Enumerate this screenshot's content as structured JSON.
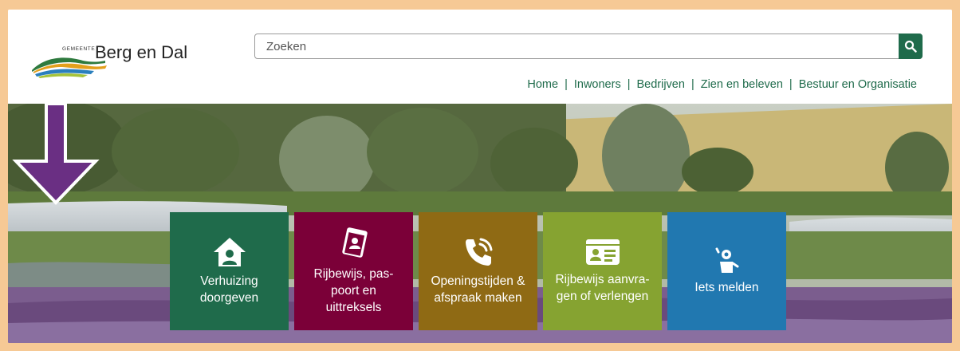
{
  "logo": {
    "small_text": "GEMEENTE",
    "name": "Berg en Dal"
  },
  "search": {
    "placeholder": "Zoeken"
  },
  "nav": {
    "items": [
      "Home",
      "Inwoners",
      "Bedrijven",
      "Zien en beleven",
      "Bestuur en Organisatie"
    ],
    "separator": "|"
  },
  "tiles": [
    {
      "label_line1": "Verhuizing",
      "label_line2": "doorgeven",
      "label_line3": "",
      "color": "#1f6b4b",
      "icon": "house-person-icon"
    },
    {
      "label_line1": "Rijbewijs, pas-",
      "label_line2": "poort en",
      "label_line3": "uittreksels",
      "color": "#7b0038",
      "icon": "passport-icon"
    },
    {
      "label_line1": "Openingstijden &",
      "label_line2": "afspraak maken",
      "label_line3": "",
      "color": "#8f6a14",
      "icon": "phone-icon"
    },
    {
      "label_line1": "Rijbewijs aanvra-",
      "label_line2": "gen of verlengen",
      "label_line3": "",
      "color": "#86a331",
      "icon": "id-card-icon"
    },
    {
      "label_line1": "Iets melden",
      "label_line2": "",
      "label_line3": "",
      "color": "#2178b0",
      "icon": "report-person-icon"
    }
  ],
  "colors": {
    "brand_green": "#1f6b4b",
    "frame": "#f6c995",
    "arrow": "#6a2f83"
  }
}
